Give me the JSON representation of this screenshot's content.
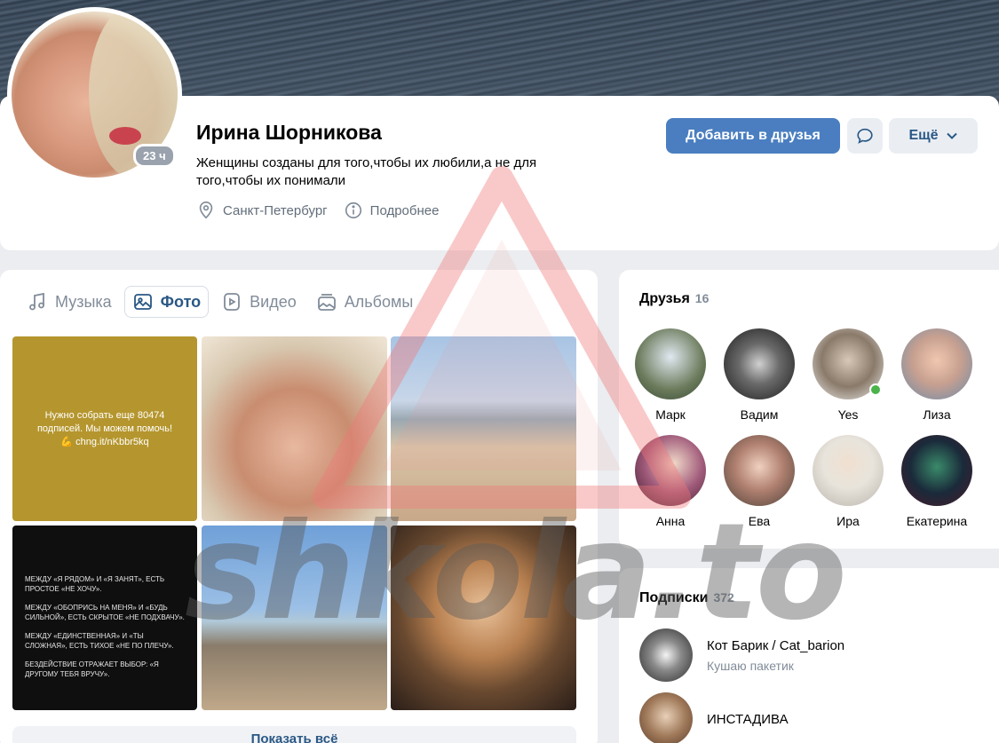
{
  "profile": {
    "name": "Ирина Шорникова",
    "last_seen": "23 ч",
    "status": "Женщины созданы для того,чтобы их любили,а не для того,чтобы их понимали",
    "city": "Санкт-Петербург",
    "details_link": "Подробнее"
  },
  "actions": {
    "add_friend": "Добавить в друзья",
    "more": "Ещё"
  },
  "media_tabs": [
    {
      "label": "Музыка",
      "icon": "music-icon"
    },
    {
      "label": "Фото",
      "icon": "photo-icon",
      "active": true
    },
    {
      "label": "Видео",
      "icon": "video-icon"
    },
    {
      "label": "Альбомы",
      "icon": "albums-icon"
    }
  ],
  "photos": {
    "p1_text": "Нужно собрать еще 80474 подписей. Мы можем помочь! 💪 chng.it/nKbbr5kq",
    "p4_lines": [
      "МЕЖДУ «Я РЯДОМ» И «Я ЗАНЯТ», ЕСТЬ ПРОСТОЕ «НЕ ХОЧУ».",
      "МЕЖДУ «ОБОПРИСЬ НА МЕНЯ» И «БУДЬ СИЛЬНОЙ», ЕСТЬ СКРЫТОЕ «НЕ ПОДХВАЧУ».",
      "МЕЖДУ «ЕДИНСТВЕННАЯ» И «ТЫ СЛОЖНАЯ», ЕСТЬ ТИХОЕ «НЕ ПО ПЛЕЧУ».",
      "БЕЗДЕЙСТВИЕ ОТРАЖАЕТ ВЫБОР: «Я ДРУГОМУ ТЕБЯ ВРУЧУ»."
    ],
    "show_all": "Показать всё"
  },
  "friends": {
    "title": "Друзья",
    "count": "16",
    "items": [
      {
        "name": "Марк",
        "color": "#6a7a5a"
      },
      {
        "name": "Вадим",
        "color": "#4a4a4a"
      },
      {
        "name": "Yes",
        "color": "#8a7a6a",
        "online": true
      },
      {
        "name": "Лиза",
        "color": "#c8a090"
      },
      {
        "name": "Анна",
        "color": "#7a3a5a"
      },
      {
        "name": "Ева",
        "color": "#b08070"
      },
      {
        "name": "Ира",
        "color": "#d8d4cc"
      },
      {
        "name": "Екатерина",
        "color": "#1a2a3a"
      }
    ]
  },
  "subscriptions": {
    "title": "Подписки",
    "count": "372",
    "items": [
      {
        "name": "Кот Барик / Cat_barion",
        "desc": "Кушаю пакетик",
        "color": "#3a3a3a"
      },
      {
        "name": "ИНСТАДИВА",
        "desc": "",
        "color": "#c8a888"
      }
    ]
  },
  "watermark": "shkola.to",
  "colors": {
    "accent": "#4a7ec0",
    "link": "#2a5885",
    "muted": "#818c99",
    "online": "#4bb34b"
  }
}
